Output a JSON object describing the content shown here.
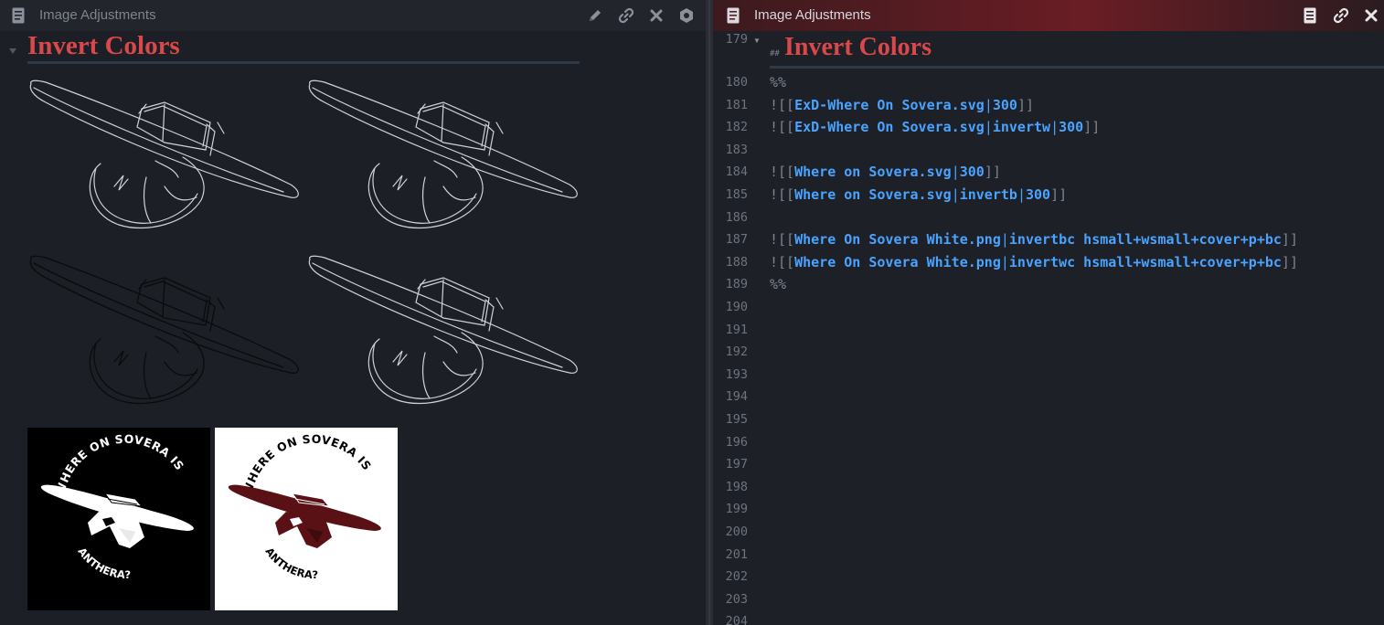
{
  "left_pane": {
    "title": "Image Adjustments",
    "heading": "Invert Colors",
    "toolbar_icons": [
      "pencil-icon",
      "link-icon",
      "close-icon",
      "settings-hexagon-icon"
    ]
  },
  "right_pane": {
    "title": "Image Adjustments",
    "toolbar_icons": [
      "reading-view-icon",
      "link-icon",
      "close-icon"
    ],
    "heading_line_number": "179",
    "heading_marker": "##",
    "heading": "Invert Colors",
    "lines": [
      {
        "n": "180",
        "parts": [
          {
            "t": "%%",
            "c": "dim"
          }
        ]
      },
      {
        "n": "181",
        "parts": [
          {
            "t": "![[",
            "c": "dim"
          },
          {
            "t": "ExD-Where On Sovera.svg",
            "c": "link"
          },
          {
            "t": "|",
            "c": "pipe"
          },
          {
            "t": "300",
            "c": "link"
          },
          {
            "t": "]]",
            "c": "dim"
          }
        ]
      },
      {
        "n": "182",
        "parts": [
          {
            "t": "![[",
            "c": "dim"
          },
          {
            "t": "ExD-Where On Sovera.svg",
            "c": "link"
          },
          {
            "t": "|",
            "c": "pipe"
          },
          {
            "t": "invertw",
            "c": "link"
          },
          {
            "t": "|",
            "c": "pipe"
          },
          {
            "t": "300",
            "c": "link"
          },
          {
            "t": "]]",
            "c": "dim"
          }
        ]
      },
      {
        "n": "183",
        "parts": []
      },
      {
        "n": "184",
        "parts": [
          {
            "t": "![[",
            "c": "dim"
          },
          {
            "t": "Where on Sovera.svg",
            "c": "link"
          },
          {
            "t": "|",
            "c": "pipe"
          },
          {
            "t": "300",
            "c": "link"
          },
          {
            "t": "]]",
            "c": "dim"
          }
        ]
      },
      {
        "n": "185",
        "parts": [
          {
            "t": "![[",
            "c": "dim"
          },
          {
            "t": "Where on Sovera.svg",
            "c": "link"
          },
          {
            "t": "|",
            "c": "pipe"
          },
          {
            "t": "invertb",
            "c": "link"
          },
          {
            "t": "|",
            "c": "pipe"
          },
          {
            "t": "300",
            "c": "link"
          },
          {
            "t": "]]",
            "c": "dim"
          }
        ]
      },
      {
        "n": "186",
        "parts": []
      },
      {
        "n": "187",
        "parts": [
          {
            "t": "![[",
            "c": "dim"
          },
          {
            "t": "Where On Sovera White.png",
            "c": "link"
          },
          {
            "t": "|",
            "c": "pipe"
          },
          {
            "t": "invertbc hsmall+wsmall+cover+p+bc",
            "c": "link"
          },
          {
            "t": "]]",
            "c": "dim"
          }
        ]
      },
      {
        "n": "188",
        "parts": [
          {
            "t": "![[",
            "c": "dim"
          },
          {
            "t": "Where On Sovera White.png",
            "c": "link"
          },
          {
            "t": "|",
            "c": "pipe"
          },
          {
            "t": "invertwc hsmall+wsmall+cover+p+bc",
            "c": "link"
          },
          {
            "t": "]]",
            "c": "dim"
          }
        ]
      },
      {
        "n": "189",
        "parts": [
          {
            "t": "%%",
            "c": "dim"
          }
        ]
      },
      {
        "n": "190",
        "parts": []
      },
      {
        "n": "191",
        "parts": []
      },
      {
        "n": "192",
        "parts": []
      },
      {
        "n": "193",
        "parts": []
      },
      {
        "n": "194",
        "parts": []
      },
      {
        "n": "195",
        "parts": []
      },
      {
        "n": "196",
        "parts": []
      },
      {
        "n": "197",
        "parts": []
      },
      {
        "n": "198",
        "parts": []
      },
      {
        "n": "199",
        "parts": []
      },
      {
        "n": "200",
        "parts": []
      },
      {
        "n": "201",
        "parts": []
      },
      {
        "n": "202",
        "parts": []
      },
      {
        "n": "203",
        "parts": []
      },
      {
        "n": "204",
        "parts": []
      }
    ]
  },
  "posters": {
    "arc_text_top": "WHERE ON SOVERA IS",
    "arc_text_bottom": "ANTHERA?"
  },
  "colors": {
    "heading": "#d9484a",
    "link": "#4aa3ff",
    "sketch_light": "#cfd2d8",
    "sketch_dark": "#0a0b0d",
    "hat_dark": "#5a1116"
  }
}
